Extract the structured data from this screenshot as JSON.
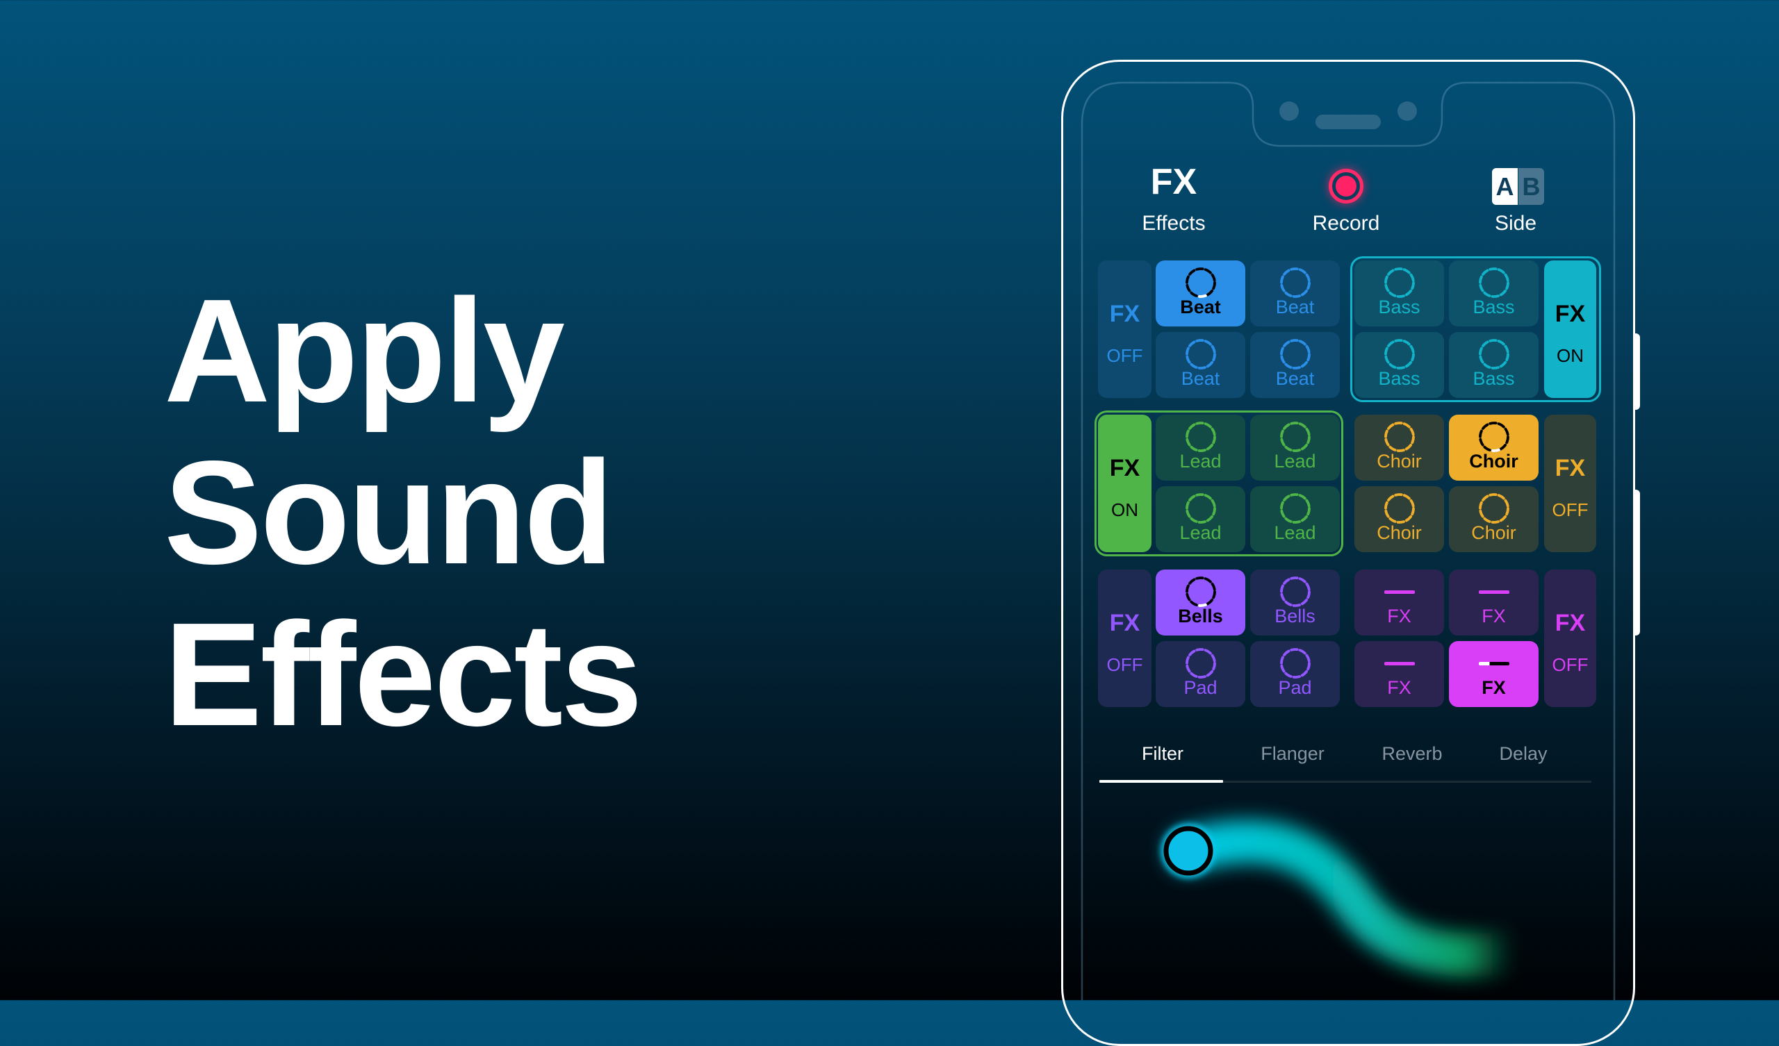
{
  "headline": [
    "Apply",
    "Sound",
    "Effects"
  ],
  "header": {
    "effects": {
      "icon_text": "FX",
      "label": "Effects"
    },
    "record": {
      "label": "Record",
      "color": "#ff2266"
    },
    "side": {
      "label": "Side",
      "a": "A",
      "b": "B",
      "active": "A"
    }
  },
  "pad_groups": [
    {
      "name": "beat",
      "color": "#2b8fe8",
      "side": "left",
      "fx": "FX",
      "state": "OFF",
      "fx_on": false,
      "pads": [
        {
          "label": "Beat",
          "active": true
        },
        {
          "label": "Beat",
          "active": false
        },
        {
          "label": "Beat",
          "active": false
        },
        {
          "label": "Beat",
          "active": false
        }
      ]
    },
    {
      "name": "bass",
      "color": "#12b3c8",
      "side": "right",
      "fx": "FX",
      "state": "ON",
      "fx_on": true,
      "pads": [
        {
          "label": "Bass",
          "active": false
        },
        {
          "label": "Bass",
          "active": false
        },
        {
          "label": "Bass",
          "active": false
        },
        {
          "label": "Bass",
          "active": false
        }
      ]
    },
    {
      "name": "lead",
      "color": "#4fb548",
      "side": "left",
      "fx": "FX",
      "state": "ON",
      "fx_on": true,
      "pads": [
        {
          "label": "Lead",
          "active": false
        },
        {
          "label": "Lead",
          "active": false
        },
        {
          "label": "Lead",
          "active": false
        },
        {
          "label": "Lead",
          "active": false
        }
      ]
    },
    {
      "name": "choir",
      "color": "#eeae2c",
      "side": "right",
      "fx": "FX",
      "state": "OFF",
      "fx_on": false,
      "pads": [
        {
          "label": "Choir",
          "active": false
        },
        {
          "label": "Choir",
          "active": true
        },
        {
          "label": "Choir",
          "active": false
        },
        {
          "label": "Choir",
          "active": false
        }
      ]
    },
    {
      "name": "bells-pad",
      "color": "#9257ff",
      "side": "left",
      "fx": "FX",
      "state": "OFF",
      "fx_on": false,
      "pads": [
        {
          "label": "Bells",
          "active": true
        },
        {
          "label": "Bells",
          "active": false
        },
        {
          "label": "Pad",
          "active": false
        },
        {
          "label": "Pad",
          "active": false
        }
      ]
    },
    {
      "name": "fx",
      "color": "#d93ff6",
      "side": "right",
      "fx": "FX",
      "state": "OFF",
      "fx_on": false,
      "bar_icons": true,
      "pads": [
        {
          "label": "FX",
          "active": false
        },
        {
          "label": "FX",
          "active": false
        },
        {
          "label": "FX",
          "active": false
        },
        {
          "label": "FX",
          "active": true,
          "progress": 0.35
        }
      ]
    }
  ],
  "tabs": [
    {
      "label": "Filter",
      "active": true
    },
    {
      "label": "Flanger",
      "active": false
    },
    {
      "label": "Reverb",
      "active": false
    },
    {
      "label": "Delay",
      "active": false
    }
  ],
  "xy_pad": {
    "effect": "Filter",
    "knob_color": "#0bbfe8",
    "trail_start_color": "#00d4f0",
    "trail_end_color": "#0fa566"
  }
}
